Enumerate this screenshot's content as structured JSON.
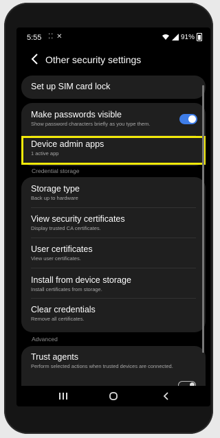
{
  "status_bar": {
    "time": "5:55",
    "glyphs": "⁚⁚ ✕",
    "battery": "91%"
  },
  "header": {
    "title": "Other security settings"
  },
  "items": [
    {
      "title": "Set up SIM card lock"
    },
    {
      "title": "Make passwords visible",
      "subtitle": "Show password characters briefly as you type them.",
      "toggle": "on"
    },
    {
      "title": "Device admin apps",
      "subtitle": "1 active app",
      "highlighted": true,
      "highlight_color": "#f3ea0a"
    },
    {
      "title": "Storage type",
      "subtitle": "Back up to hardware"
    },
    {
      "title": "View security certificates",
      "subtitle": "Display trusted CA certificates."
    },
    {
      "title": "User certificates",
      "subtitle": "View user certificates."
    },
    {
      "title": "Install from device storage",
      "subtitle": "Install certificates from storage."
    },
    {
      "title": "Clear credentials",
      "subtitle": "Remove all certificates."
    },
    {
      "title": "Trust agents",
      "subtitle": "Perform selected actions when trusted devices are connected."
    }
  ],
  "sections": {
    "credential_storage": "Credential storage",
    "advanced": "Advanced"
  },
  "colors": {
    "accent": "#3e7de8",
    "highlight": "#f3ea0a",
    "background": "#000000",
    "card": "#1f1f1f"
  },
  "nav": {
    "recents_icon": "recents-icon",
    "home_icon": "home-icon",
    "back_icon": "back-icon"
  }
}
